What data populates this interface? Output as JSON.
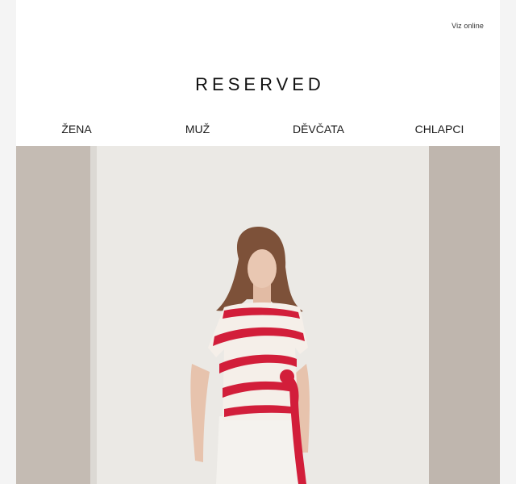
{
  "header": {
    "view_online": "Viz online",
    "logo": "RESERVED"
  },
  "nav": {
    "items": [
      {
        "label": "ŽENA"
      },
      {
        "label": "MUŽ"
      },
      {
        "label": "DĚVČATA"
      },
      {
        "label": "CHLAPCI"
      }
    ]
  },
  "hero": {
    "colors": {
      "wall_left": "#bdb5ae",
      "backdrop": "#ebe9e5",
      "stripe": "#d21e3a",
      "shirt": "#f5efe9",
      "hair": "#8a5c40",
      "skin": "#e7c3ad"
    }
  }
}
